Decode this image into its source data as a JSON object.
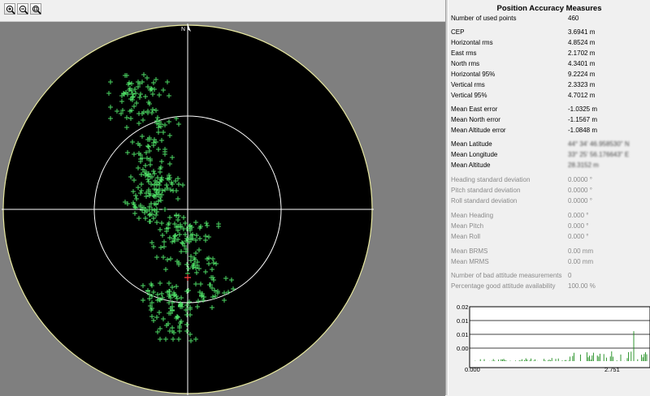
{
  "toolbar": {
    "buttons": [
      {
        "name": "zoom-in-icon"
      },
      {
        "name": "zoom-out-icon"
      },
      {
        "name": "zoom-fit-icon"
      }
    ]
  },
  "plot": {
    "north_label": "N",
    "colors": {
      "background": "#000000",
      "frame": "#7f7f7f",
      "outer_circle": "#e8e8a0",
      "crosshair": "#ffffff",
      "points": "#4cd964",
      "center": "#ff4040"
    }
  },
  "panel": {
    "title": "Position Accuracy Measures",
    "used_points_label": "Number of used points",
    "used_points_value": "460",
    "group1": [
      {
        "label": "CEP",
        "value": "3.6941 m"
      },
      {
        "label": "Horizontal rms",
        "value": "4.8524 m"
      },
      {
        "label": "East rms",
        "value": "2.1702 m"
      },
      {
        "label": "North rms",
        "value": "4.3401 m"
      },
      {
        "label": "Horizontal 95%",
        "value": "9.2224 m"
      },
      {
        "label": "Vertical rms",
        "value": "2.3323 m"
      },
      {
        "label": "Vertical 95%",
        "value": "4.7012 m"
      }
    ],
    "group2": [
      {
        "label": "Mean East error",
        "value": "-1.0325 m"
      },
      {
        "label": "Mean North error",
        "value": "-1.1567 m"
      },
      {
        "label": "Mean Altitude error",
        "value": "-1.0848 m"
      }
    ],
    "group3": [
      {
        "label": "Mean Latitude",
        "value": "44° 34' 46.958530\" N"
      },
      {
        "label": "Mean Longitude",
        "value": "33° 25' 56.176643\" E"
      },
      {
        "label": "Mean Altitude",
        "value": "28.3152 m"
      }
    ],
    "group4": [
      {
        "label": "Heading standard deviation",
        "value": "0.0000 °"
      },
      {
        "label": "Pitch standard deviation",
        "value": "0.0000 °"
      },
      {
        "label": "Roll standard deviation",
        "value": "0.0000 °"
      }
    ],
    "group5": [
      {
        "label": "Mean Heading",
        "value": "0.000 °"
      },
      {
        "label": "Mean Pitch",
        "value": "0.000 °"
      },
      {
        "label": "Mean Roll",
        "value": "0.000 °"
      }
    ],
    "group6": [
      {
        "label": "Mean BRMS",
        "value": "0.00 mm"
      },
      {
        "label": "Mean MRMS",
        "value": "0.00 mm"
      }
    ],
    "group7": [
      {
        "label": "Number of bad attitude measurements",
        "value": "0"
      },
      {
        "label": "Percentage good attitude availability",
        "value": "100.00 %"
      }
    ]
  },
  "spark": {
    "y_ticks": [
      "0.02",
      "0.01",
      "0.01",
      "0.00"
    ],
    "x_ticks": [
      "0.000",
      "2.751"
    ],
    "bar_color": "#1a8a1a"
  }
}
